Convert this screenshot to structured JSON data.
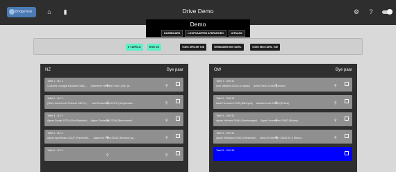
{
  "topbar": {
    "logo_text": "Bridgevisie",
    "app_title": "Drive Demo",
    "icons": [
      "home-icon",
      "trash-icon",
      "gear-icon",
      "help-icon",
      "toggle-icon"
    ]
  },
  "subbar": {
    "title": "Demo",
    "nav": [
      "DASHBOARD",
      "LOOPKAARTEN AFDRUKKEN",
      "UITSLAG"
    ]
  },
  "controls": {
    "tables_pill": "5 TAFELS",
    "bye_pill": "BYE 2X",
    "buttons": [
      "VOEG SPELER TOE",
      "VERWIJDER EEN TAFEL",
      "VOEG EEN TAFEL TOE"
    ]
  },
  "colors": {
    "pill": "#5bf0c8",
    "selected": "#0000ff"
  },
  "columns": [
    {
      "name": "NZ",
      "bye_label": "Bye paar",
      "tables": [
        {
          "name": "Tafel 1 - NZ 1",
          "players": "Codorniz Luongolt Elizabeth 348C...",
          "players2": "(Waerkeirt Hermine Fane 12467 (6...",
          "selected": false
        },
        {
          "name": "Tafel 2 - NZ 2",
          "players": "(Wim) Jemoens M Pisende 34071 (...",
          "players2": "Aart Rossenbad 34170 (Hengelruste...",
          "selected": false
        },
        {
          "name": "Tafel 3 - NZ 3",
          "players": "Agnes Bontje 15739 (Sint-Winbaert)",
          "players2": "Agnes Gantarola 37048 (Bruschmeid...",
          "selected": false
        },
        {
          "name": "Tafel 4 - NZ 4",
          "players": "Agnes Appelmans 23237 (Poperheid...",
          "players2": "Agnes De Prins 23242 (Erubblar (sp...",
          "selected": false
        },
        {
          "name": "Tafel 5 - NZ 5",
          "players": "",
          "players2": "",
          "selected": false
        }
      ]
    },
    {
      "name": "OW",
      "bye_label": "Bye paar",
      "tables": [
        {
          "name": "Tafel 1 - OW 31",
          "players": "Abel Vallaeys 21053 (Lenland)",
          "players2": "Achiel Ravin 13486 (Leuven)",
          "selected": false
        },
        {
          "name": "Tafel 2 - OW 32",
          "players": "Adolf Hermans 11758 (Bilzerynd)",
          "players2": "Adriaan Dons 23484 (Riviera)",
          "selected": false
        },
        {
          "name": "Tafel 3 - OW 33",
          "players": "Agnes Verbeek 28464 (Umstmergen)",
          "players2": "Agnes Vermeulen 32697 (Riviera)",
          "selected": false
        },
        {
          "name": "Tafel 4 - OW 34",
          "players": "Agnes Melissens 29543 (Westende)",
          "players2": "Alexa De Meester 34025 (B. A Manon...",
          "selected": false
        },
        {
          "name": "Tafel 5 - OW 35",
          "players": "",
          "players2": "",
          "selected": true
        }
      ]
    }
  ]
}
